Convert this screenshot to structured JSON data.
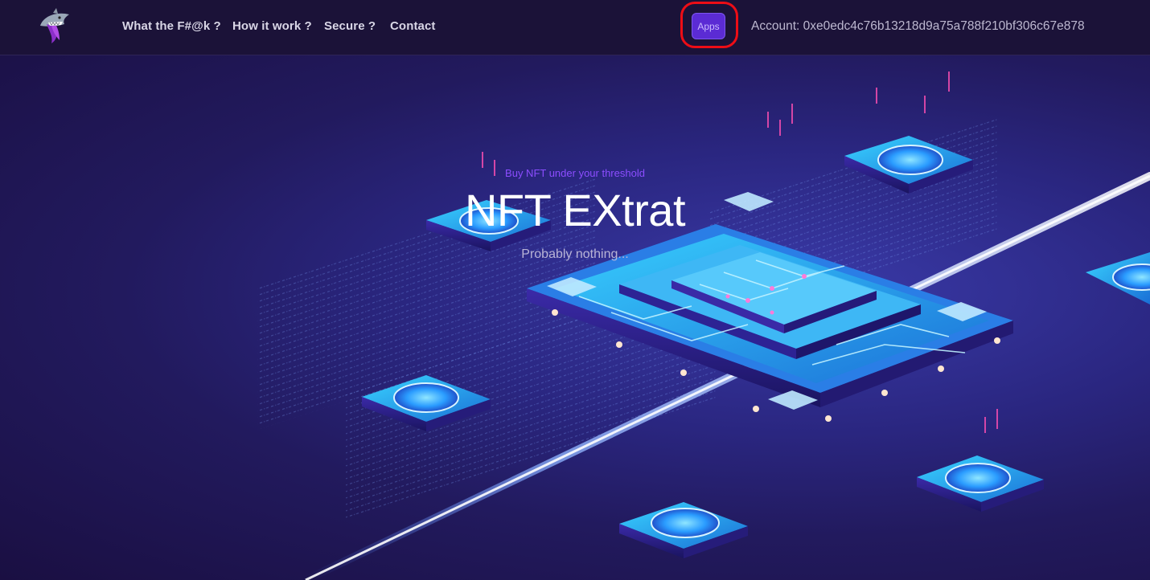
{
  "nav": {
    "links": [
      "What the F#@k ?",
      "How it work ?",
      "Secure ?",
      "Contact"
    ],
    "apps_label": "Apps",
    "account": "Account: 0xe0edc4c76b13218d9a75a788f210bf306c67e878"
  },
  "hero": {
    "tagline": "Buy NFT under your threshold",
    "title": "NFT EXtrat",
    "subtitle": "Probably nothing..."
  },
  "colors": {
    "accent": "#5b2bd4",
    "tagline": "#8c4dff",
    "highlight": "#ee0d16",
    "chip": "#2fb8f0"
  },
  "icons": {
    "logo": "shark-logo-icon"
  }
}
